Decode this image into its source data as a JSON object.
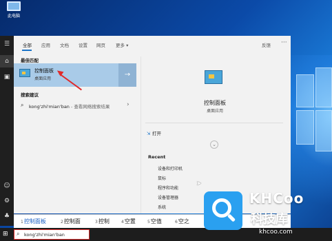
{
  "desktop": {
    "icon_label": "此电脑"
  },
  "tabs": [
    "全部",
    "应用",
    "文档",
    "设置",
    "网页",
    "更多 ▾"
  ],
  "header": {
    "feedback": "反馈",
    "more": "···"
  },
  "best_match": {
    "section_title": "最佳匹配",
    "name": "控制面板",
    "subtitle": "桌面应用",
    "arrow": "→"
  },
  "suggestions": {
    "section_title": "搜索建议",
    "item_query": "kong'zhi'mian'ban",
    "item_hint": " - 查看网络搜索结果",
    "chevron": "›"
  },
  "detail": {
    "title": "控制面板",
    "subtitle": "桌面应用",
    "open_label": "打开",
    "expand": "⌄",
    "recent_title": "Recent",
    "recent_items": [
      "设备和打印机",
      "鼠标",
      "程序和功能",
      "设备管理器",
      "系统"
    ]
  },
  "ime": {
    "candidates": [
      {
        "n": "1",
        "text": "控制面板"
      },
      {
        "n": "2",
        "text": "控制面"
      },
      {
        "n": "3",
        "text": "控制"
      },
      {
        "n": "4",
        "text": "空置"
      },
      {
        "n": "5",
        "text": "空值"
      },
      {
        "n": "6",
        "text": "空之"
      }
    ]
  },
  "taskbar": {
    "search_text": "kong'zhi'mian'ban"
  },
  "watermark": {
    "brand": "KHCoo",
    "cn": "科技库",
    "url": "khcoo.com"
  },
  "colors": {
    "accent": "#1a73c8",
    "selected": "#a9cbe8",
    "annotation_red": "#e02a2a"
  }
}
